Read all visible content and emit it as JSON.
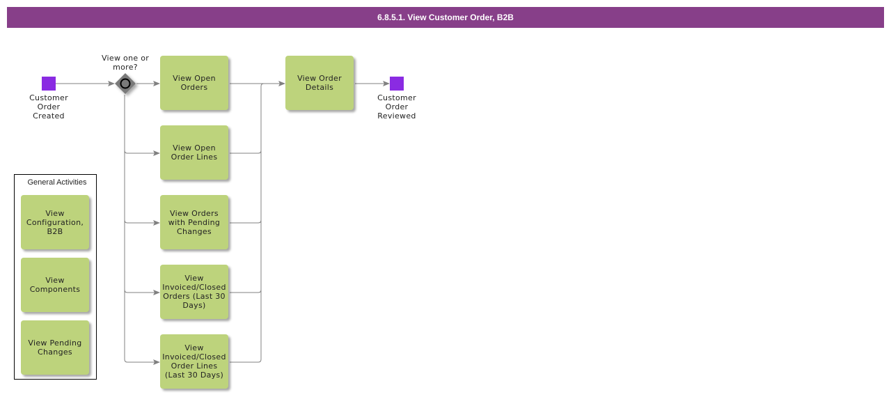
{
  "title": "6.8.5.1. View Customer Order, B2B",
  "colors": {
    "title_bar": "#873f89",
    "task_fill": "#bdd37c",
    "event_fill": "#8a2be2",
    "gateway_fill": "#7a7a7a",
    "connector": "#808080"
  },
  "start_event": {
    "label": "Customer\nOrder\nCreated"
  },
  "gateway": {
    "label": "View one or\nmore?",
    "type": "inclusive"
  },
  "tasks": [
    {
      "label": "View Open\nOrders"
    },
    {
      "label": "View Open\nOrder Lines"
    },
    {
      "label": "View Orders\nwith Pending\nChanges"
    },
    {
      "label": "View\nInvoiced/Closed\nOrders (Last 30\nDays)"
    },
    {
      "label": "View\nInvoiced/Closed\nOrder Lines\n(Last 30 Days)"
    }
  ],
  "details_task": {
    "label": "View Order\nDetails"
  },
  "end_event": {
    "label": "Customer\nOrder\nReviewed"
  },
  "general_activities": {
    "title": "General Activities",
    "items": [
      {
        "label": "View\nConfiguration,\nB2B"
      },
      {
        "label": "View\nComponents"
      },
      {
        "label": "View Pending\nChanges"
      }
    ]
  }
}
